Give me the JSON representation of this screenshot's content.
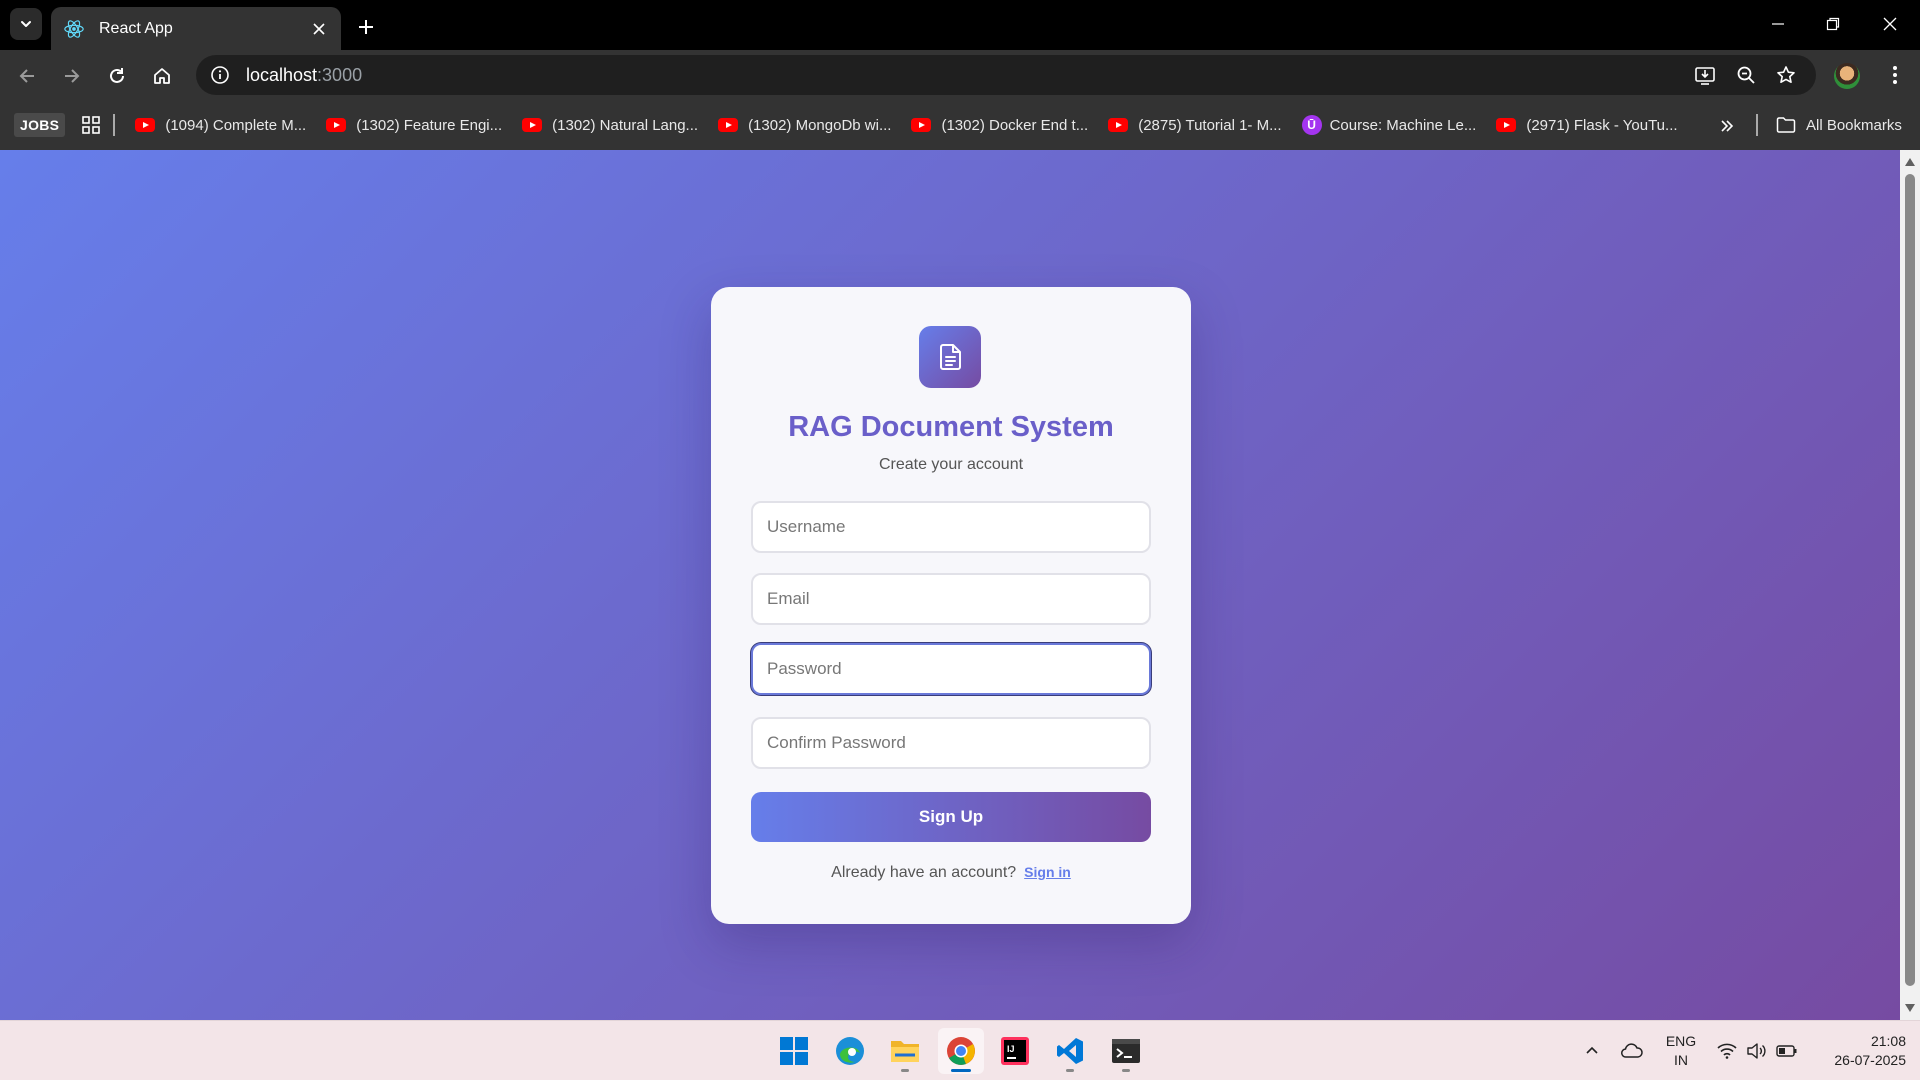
{
  "browser": {
    "tab": {
      "title": "React App"
    },
    "url": {
      "host": "localhost",
      "port": ":3000"
    },
    "bookmarks": {
      "jobs_label": "JOBS",
      "items": [
        {
          "label": "(1094) Complete M...",
          "icon": "youtube-icon"
        },
        {
          "label": "(1302) Feature Engi...",
          "icon": "youtube-icon"
        },
        {
          "label": "(1302) Natural Lang...",
          "icon": "youtube-icon"
        },
        {
          "label": "(1302) MongoDb wi...",
          "icon": "youtube-icon"
        },
        {
          "label": "(1302) Docker End t...",
          "icon": "youtube-icon"
        },
        {
          "label": "(2875) Tutorial 1- M...",
          "icon": "youtube-icon"
        },
        {
          "label": "Course: Machine Le...",
          "icon": "udemy-icon"
        },
        {
          "label": "(2971) Flask - YouTu...",
          "icon": "youtube-icon"
        }
      ],
      "all_bookmarks": "All Bookmarks"
    }
  },
  "page": {
    "title": "RAG Document System",
    "subtitle": "Create your account",
    "form": {
      "username_placeholder": "Username",
      "email_placeholder": "Email",
      "password_placeholder": "Password",
      "confirm_password_placeholder": "Confirm Password",
      "submit_label": "Sign Up",
      "focused_field": "password"
    },
    "signin": {
      "prompt": "Already have an account?",
      "link_label": "Sign in"
    },
    "colors": {
      "gradient_start": "#667eea",
      "gradient_end": "#764ba2",
      "title": "#6a5fc9"
    }
  },
  "taskbar": {
    "apps": [
      "windows-start",
      "edge",
      "file-explorer",
      "chrome",
      "intellij",
      "vscode",
      "terminal"
    ],
    "active_app": "chrome",
    "language": {
      "line1": "ENG",
      "line2": "IN"
    },
    "time": "21:08",
    "date": "26-07-2025"
  }
}
